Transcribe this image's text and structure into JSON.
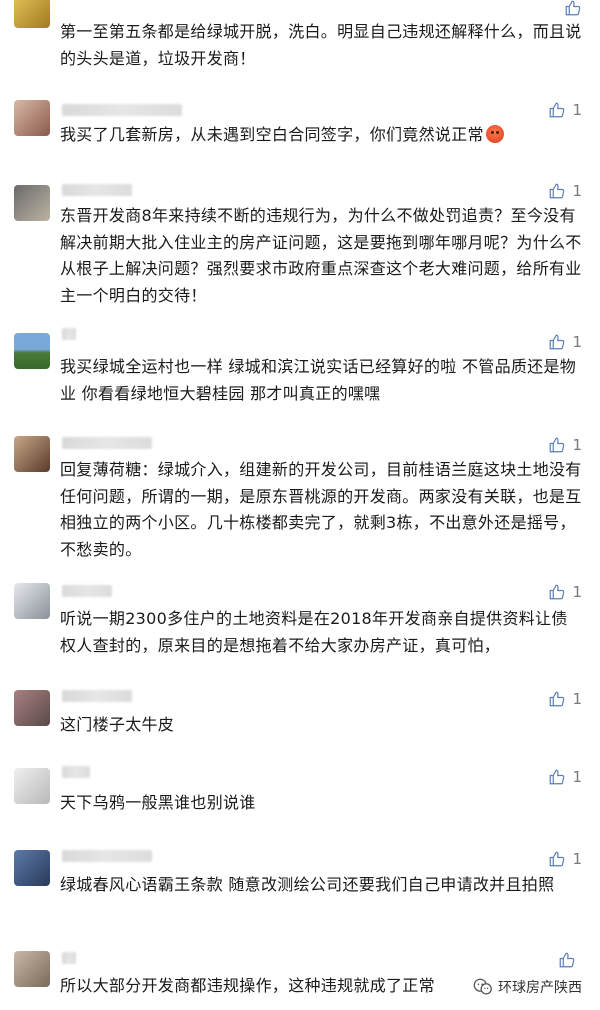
{
  "comments": [
    {
      "id": "c1",
      "text": "第一至第五条都是给绿城开脱，洗白。明显自己违规还解释什么，而且说的头头是道，垃圾开发商！",
      "likes": "",
      "avatar_color": "#c9a13a"
    },
    {
      "id": "c2",
      "text": "我买了几套新房，从未遇到空白合同签字，你们竟然说正常",
      "likes": "1",
      "avatar_color": "#b58c7a"
    },
    {
      "id": "c3",
      "text": "东晋开发商8年来持续不断的违规行为，为什么不做处罚追责？至今没有解决前期大批入住业主的房产证问题，这是要拖到哪年哪月呢？为什么不从根子上解决问题？强烈要求市政府重点深查这个老大难问题，给所有业主一个明白的交待！",
      "likes": "1",
      "avatar_color": "#8a7e6e"
    },
    {
      "id": "c4",
      "text": "我买绿城全运村也一样 绿城和滨江说实话已经算好的啦 不管品质还是物业 你看看绿地恒大碧桂园 那才叫真正的嘿嘿",
      "likes": "1",
      "avatar_color": "#4a7a3a"
    },
    {
      "id": "c5",
      "text": "回复薄荷糖：绿城介入，组建新的开发公司，目前桂语兰庭这块土地没有任何问题，所谓的一期，是原东晋桃源的开发商。两家没有关联，也是互相独立的两个小区。几十栋楼都卖完了，就剩3栋，不出意外还是摇号，不愁卖的。",
      "likes": "1",
      "avatar_color": "#8a5a3a"
    },
    {
      "id": "c6",
      "text": "听说一期2300多住户的土地资料是在2018年开发商亲自提供资料让债权人查封的，原来目的是想拖着不给大家办房产证，真可怕，",
      "likes": "1",
      "avatar_color": "#9aa0a8"
    },
    {
      "id": "c7",
      "text": "这门楼子太牛皮",
      "likes": "1",
      "avatar_color": "#8a6a6a"
    },
    {
      "id": "c8",
      "text": "天下乌鸦一般黑谁也别说谁",
      "likes": "1",
      "avatar_color": "#c8c8c8"
    },
    {
      "id": "c9",
      "text": "绿城春风心语霸王条款 随意改测绘公司还要我们自己申请改并且拍照",
      "likes": "1",
      "avatar_color": "#3a5a8a"
    },
    {
      "id": "c10",
      "text": "所以大部分开发商都违规操作，这种违规就成了正常",
      "likes": "",
      "avatar_color": "#a89888"
    }
  ],
  "watermark": {
    "label": "环球房产陕西"
  },
  "colors": {
    "text": "#1a1a1a",
    "meta": "#7a7a7a",
    "background": "#ffffff"
  }
}
